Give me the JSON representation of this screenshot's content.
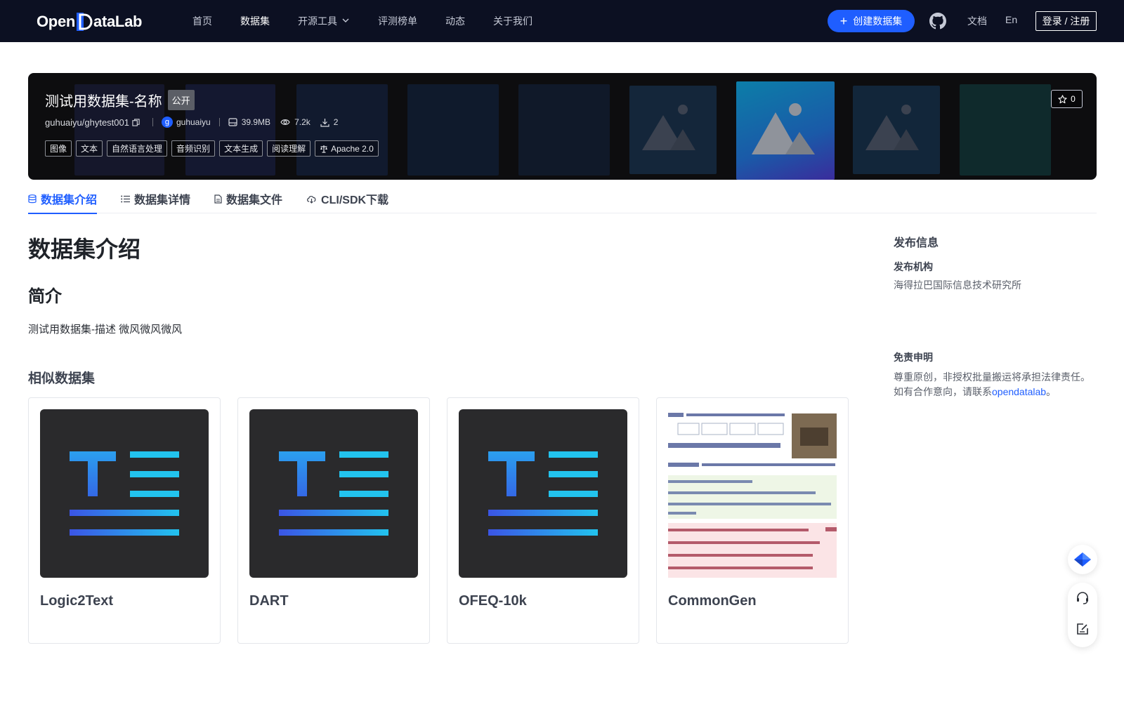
{
  "header": {
    "logo_text_left": "Open",
    "logo_text_right": "ataLab",
    "nav": [
      {
        "label": "首页"
      },
      {
        "label": "数据集"
      },
      {
        "label": "开源工具"
      },
      {
        "label": "评测榜单"
      },
      {
        "label": "动态"
      },
      {
        "label": "关于我们"
      }
    ],
    "create_button": "创建数据集",
    "docs_link": "文档",
    "lang_link": "En",
    "login_button": "登录 / 注册"
  },
  "banner": {
    "title": "测试用数据集-名称",
    "visibility": "公开",
    "repo_path": "guhuaiyu/ghytest001",
    "owner_initial": "g",
    "owner": "guhuaiyu",
    "size": "39.9MB",
    "views": "7.2k",
    "downloads": "2",
    "tags": [
      "图像",
      "文本",
      "自然语言处理",
      "音频识别",
      "文本生成",
      "阅读理解"
    ],
    "license": "Apache 2.0",
    "stars": "0"
  },
  "tabs": [
    {
      "label": "数据集介绍"
    },
    {
      "label": "数据集详情"
    },
    {
      "label": "数据集文件"
    },
    {
      "label": "CLI/SDK下载"
    }
  ],
  "main": {
    "title": "数据集介绍",
    "intro_heading": "简介",
    "description": "测试用数据集-描述 微风微风微风",
    "similar_heading": "相似数据集",
    "similar": [
      {
        "name": "Logic2Text",
        "thumb": "text-icon"
      },
      {
        "name": "DART",
        "thumb": "text-icon"
      },
      {
        "name": "OFEQ-10k",
        "thumb": "text-icon"
      },
      {
        "name": "CommonGen",
        "thumb": "paper-preview"
      }
    ]
  },
  "sidebar": {
    "heading": "发布信息",
    "publisher_label": "发布机构",
    "publisher": "海得拉巴国际信息技术研究所",
    "disclaimer_label": "免责申明",
    "disclaimer_line1": "尊重原创，非授权批量搬运将承担法律责任。",
    "disclaimer_line2_prefix": "如有合作意向，请联系",
    "disclaimer_link": "opendatalab",
    "disclaimer_line2_suffix": "。"
  },
  "colors": {
    "nav_bg": "#0c1022",
    "accent": "#1f5eff",
    "banner_bg": "#0d0d0f"
  }
}
